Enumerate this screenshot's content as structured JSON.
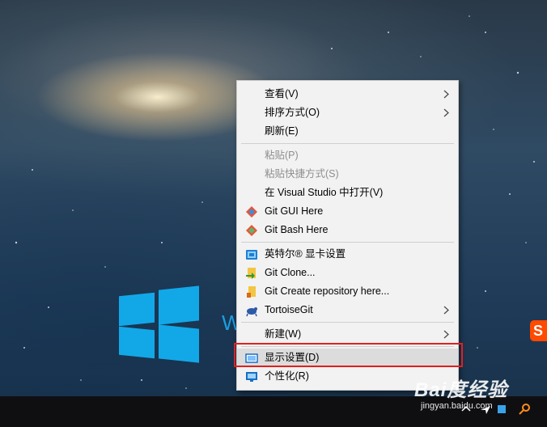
{
  "desktop": {
    "windows_wordmark": "W",
    "ime_badge": "S"
  },
  "context_menu": {
    "items": [
      {
        "label": "查看(V)",
        "has_submenu": true,
        "disabled": false,
        "icon": null
      },
      {
        "label": "排序方式(O)",
        "has_submenu": true,
        "disabled": false,
        "icon": null
      },
      {
        "label": "刷新(E)",
        "has_submenu": false,
        "disabled": false,
        "icon": null
      },
      {
        "label": "粘贴(P)",
        "has_submenu": false,
        "disabled": true,
        "icon": null
      },
      {
        "label": "粘贴快捷方式(S)",
        "has_submenu": false,
        "disabled": true,
        "icon": null
      },
      {
        "label": "在 Visual Studio 中打开(V)",
        "has_submenu": false,
        "disabled": false,
        "icon": null
      },
      {
        "label": "Git GUI Here",
        "has_submenu": false,
        "disabled": false,
        "icon": "git-gui-icon"
      },
      {
        "label": "Git Bash Here",
        "has_submenu": false,
        "disabled": false,
        "icon": "git-bash-icon"
      },
      {
        "label": "英特尔® 显卡设置",
        "has_submenu": false,
        "disabled": false,
        "icon": "intel-graphics-icon"
      },
      {
        "label": "Git Clone...",
        "has_submenu": false,
        "disabled": false,
        "icon": "git-clone-icon"
      },
      {
        "label": "Git Create repository here...",
        "has_submenu": false,
        "disabled": false,
        "icon": "git-create-repo-icon"
      },
      {
        "label": "TortoiseGit",
        "has_submenu": true,
        "disabled": false,
        "icon": "tortoisegit-icon"
      },
      {
        "label": "新建(W)",
        "has_submenu": true,
        "disabled": false,
        "icon": null
      },
      {
        "label": "显示设置(D)",
        "has_submenu": false,
        "disabled": false,
        "icon": "display-settings-icon",
        "highlighted": true
      },
      {
        "label": "个性化(R)",
        "has_submenu": false,
        "disabled": false,
        "icon": "personalize-icon"
      }
    ]
  },
  "watermark": {
    "logo_text": "Bai度经验",
    "url": "jingyan.baidu.com"
  },
  "colors": {
    "menu_bg": "#f2f2f2",
    "highlight_border": "#e02020",
    "windows_logo": "#12a8e8"
  }
}
